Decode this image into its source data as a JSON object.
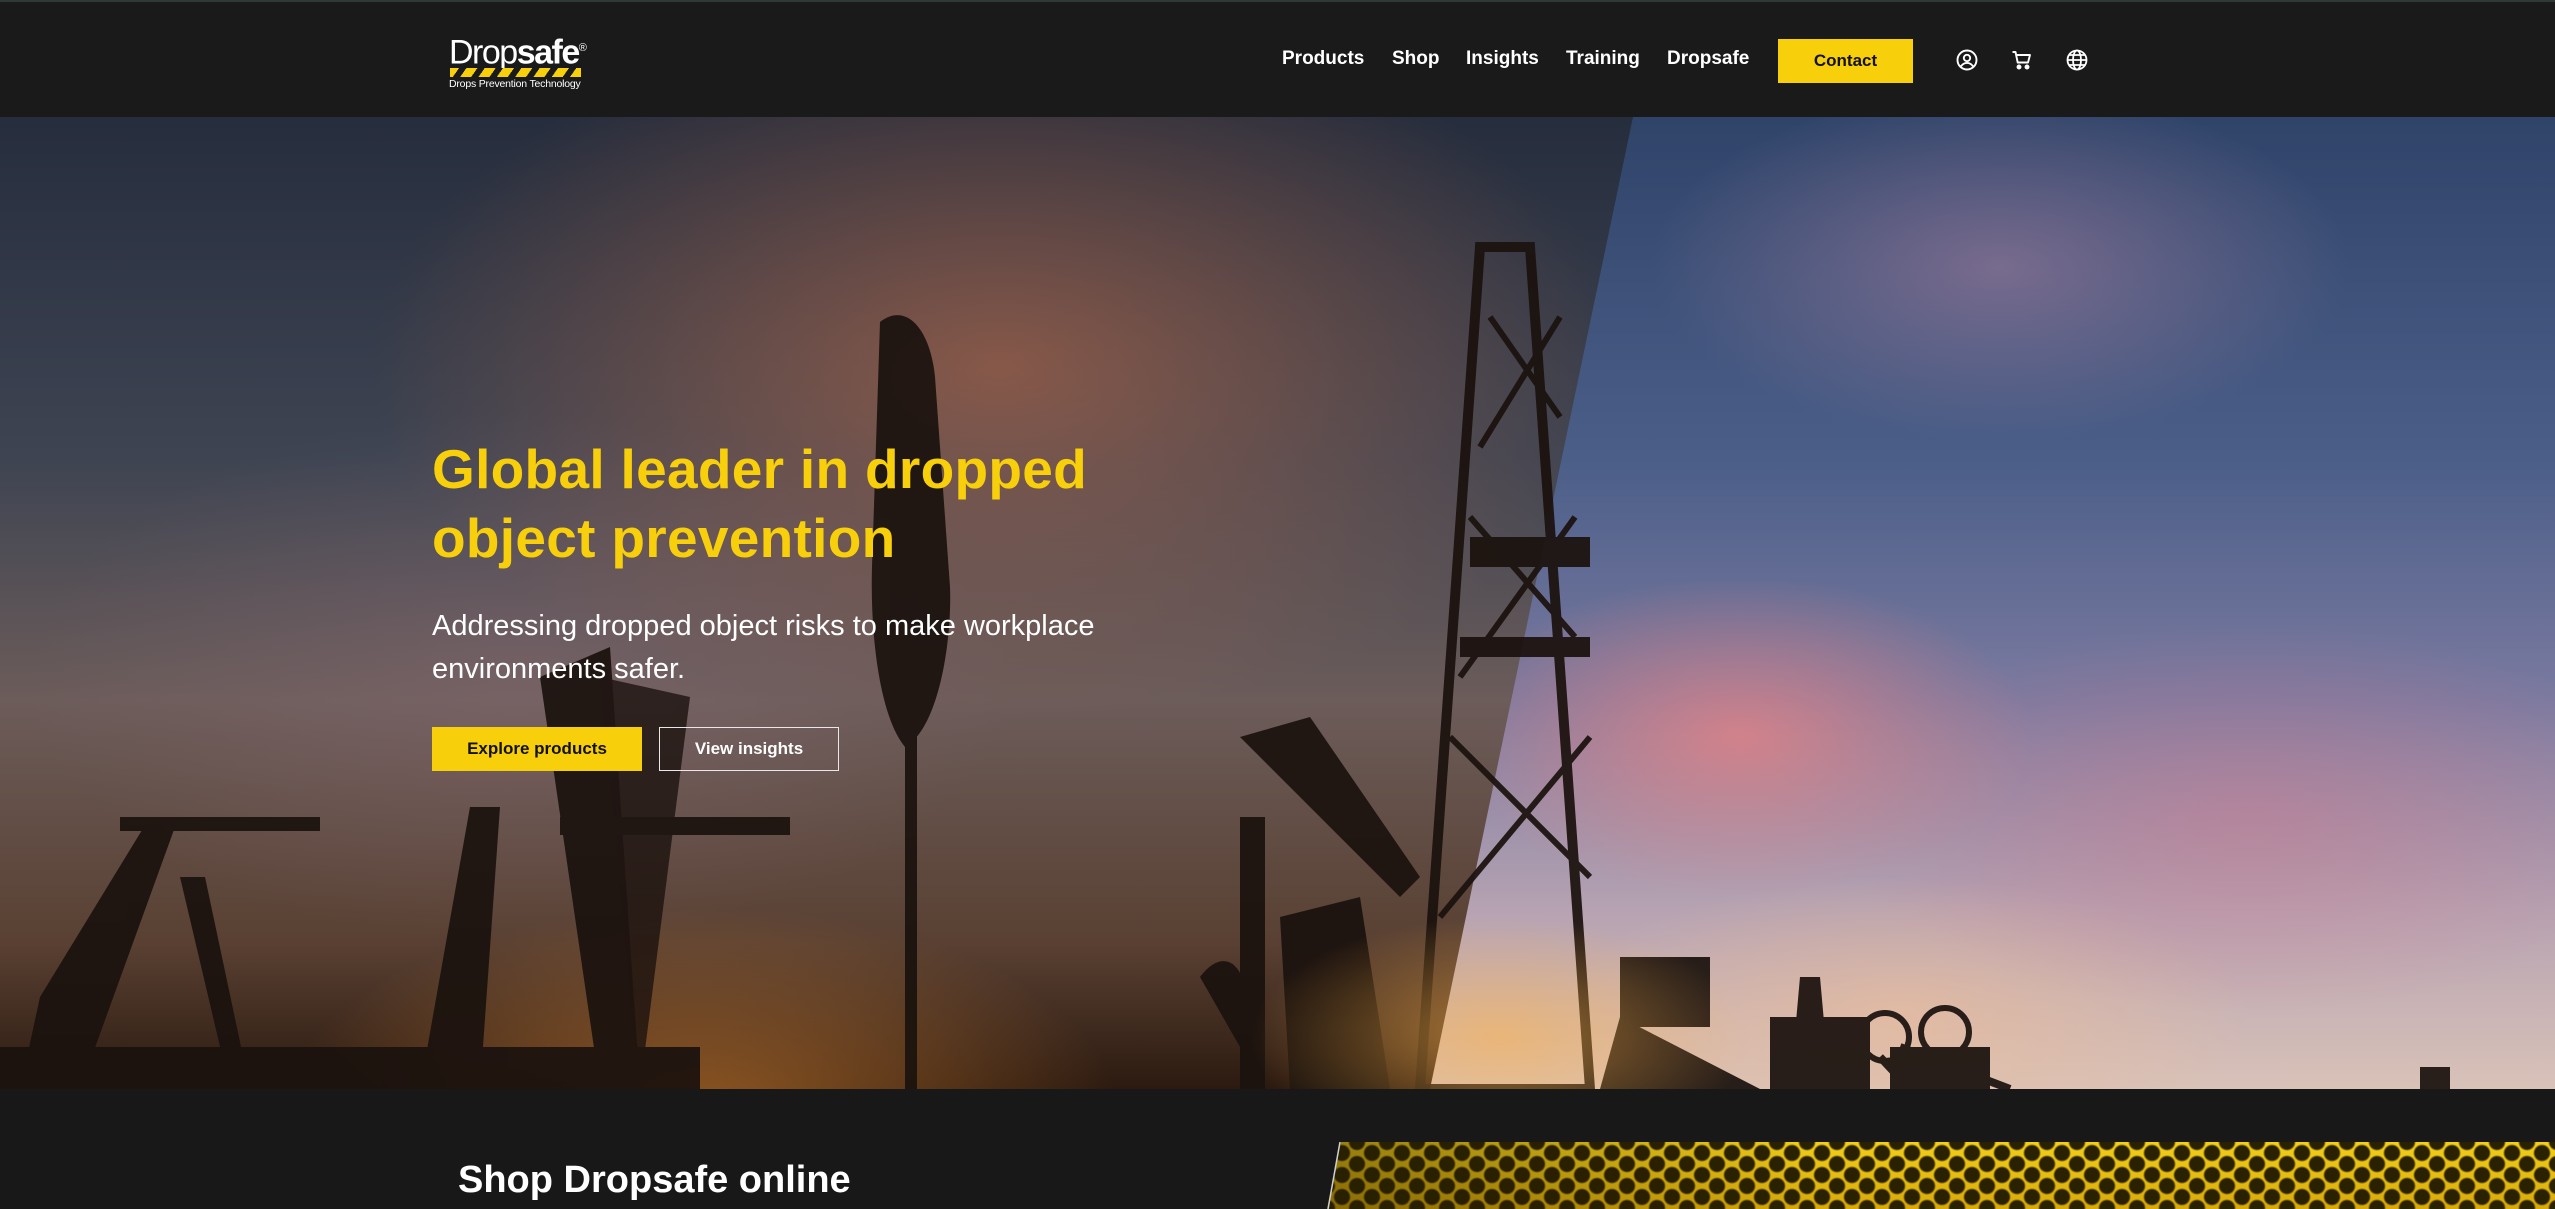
{
  "header": {
    "logo": {
      "word_light": "Drop",
      "word_bold": "safe",
      "registered": "®",
      "tagline": "Drops Prevention Technology"
    },
    "nav": [
      {
        "label": "Products"
      },
      {
        "label": "Shop"
      },
      {
        "label": "Insights"
      },
      {
        "label": "Training"
      },
      {
        "label": "Dropsafe"
      }
    ],
    "contact_label": "Contact",
    "icons": [
      "user-account-icon",
      "shopping-cart-icon",
      "globe-language-icon"
    ]
  },
  "hero": {
    "title": "Global leader in dropped object prevention",
    "subtitle": "Addressing dropped object risks to make workplace environments safer.",
    "primary_button": "Explore products",
    "secondary_button": "View insights",
    "image_description_icon": "oilfield-sunset-image"
  },
  "shop_section": {
    "title": "Shop Dropsafe online"
  },
  "colors": {
    "accent": "#f7cf0a",
    "header_bg": "#1a1a1a",
    "page_bg": "#181818",
    "text_light": "#ffffff"
  }
}
